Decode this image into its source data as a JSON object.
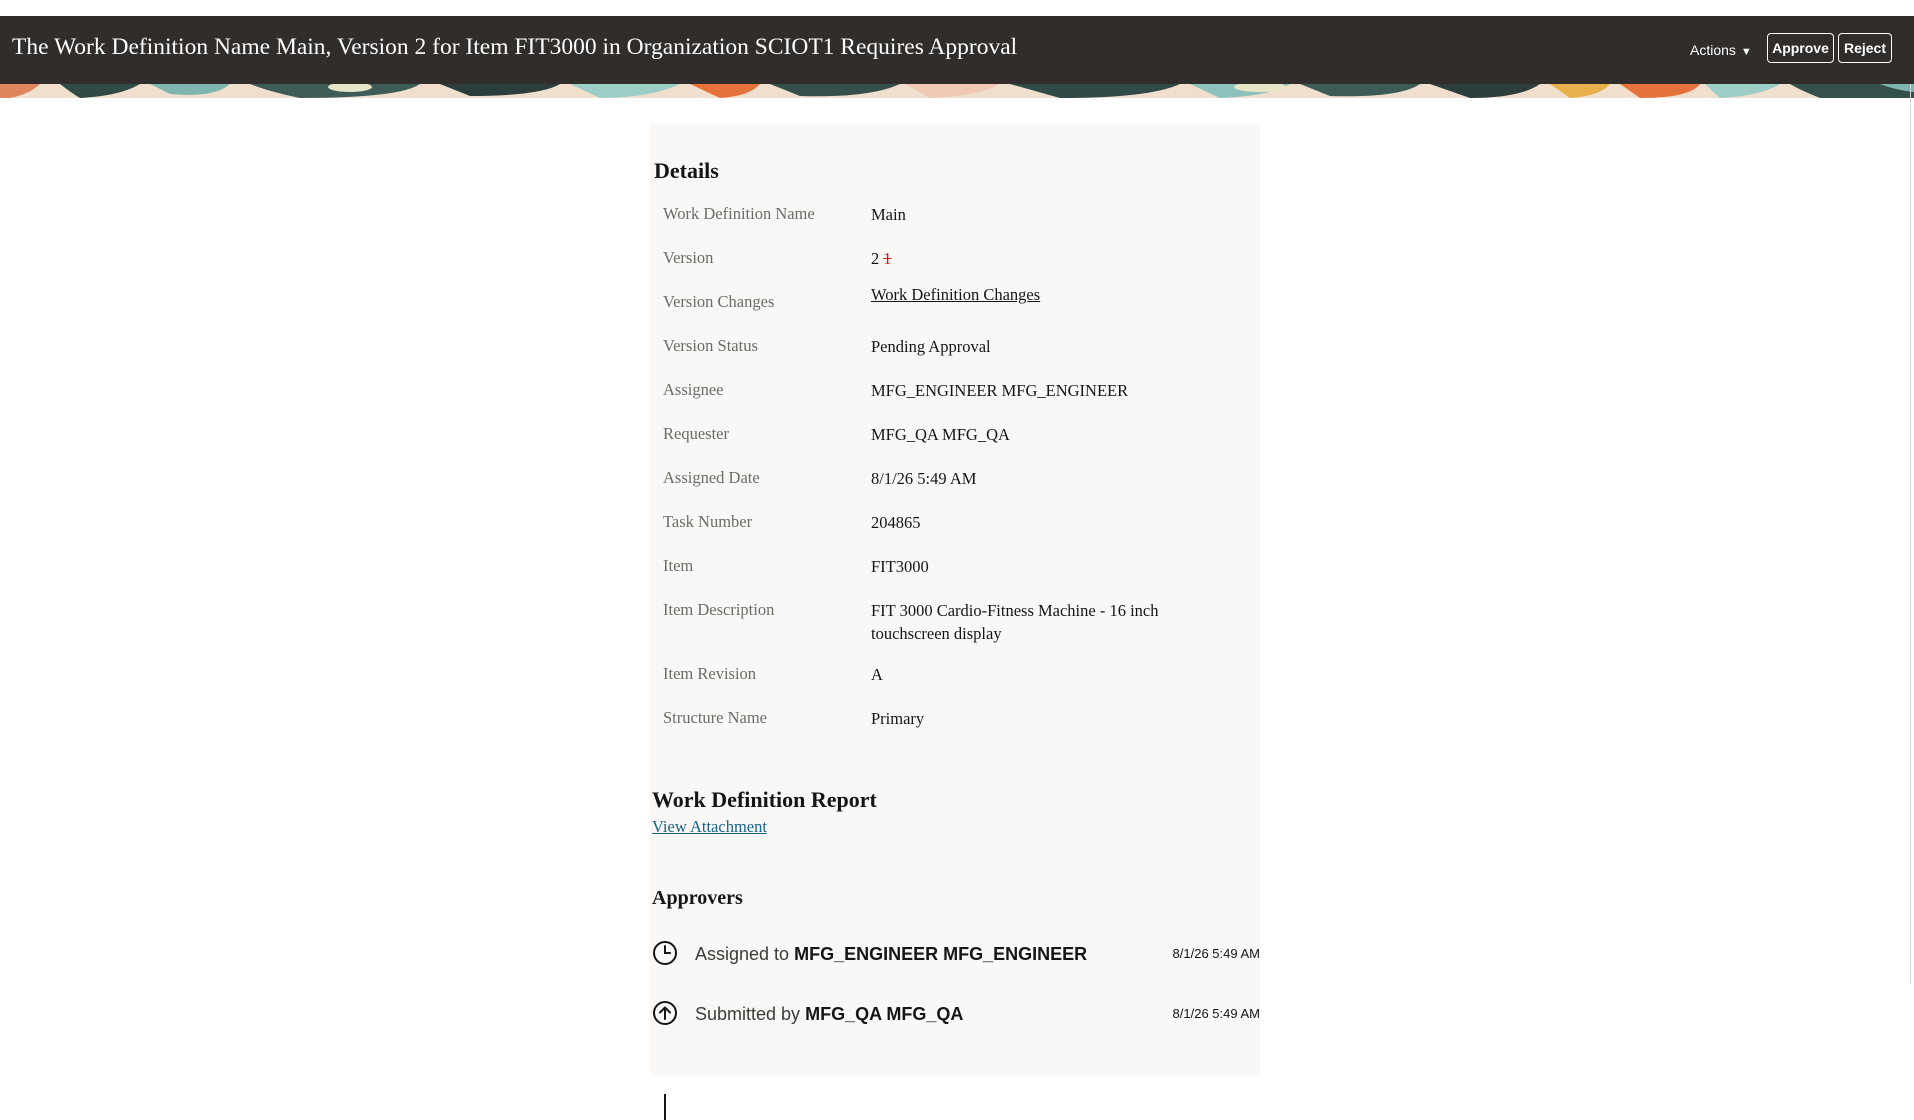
{
  "header": {
    "title": "The Work Definition Name Main, Version 2 for Item FIT3000 in Organization SCIOT1 Requires Approval",
    "actions_label": "Actions",
    "approve_label": "Approve",
    "reject_label": "Reject",
    "caret_icon": "chevron-down-icon",
    "background_color": "#312d2a"
  },
  "details": {
    "title": "Details",
    "fields": {
      "work_definition_name": {
        "label": "Work Definition Name",
        "value": "Main"
      },
      "version": {
        "label": "Version",
        "value": "2",
        "previous_value": "1"
      },
      "version_changes": {
        "label": "Version Changes",
        "value": "Work Definition Changes"
      },
      "version_status": {
        "label": "Version Status",
        "value": "Pending Approval"
      },
      "assignee": {
        "label": "Assignee",
        "value": "MFG_ENGINEER MFG_ENGINEER"
      },
      "requester": {
        "label": "Requester",
        "value": "MFG_QA MFG_QA"
      },
      "assigned_date": {
        "label": "Assigned Date",
        "value": "8/1/26 5:49 AM"
      },
      "task_number": {
        "label": "Task Number",
        "value": "204865"
      },
      "item": {
        "label": "Item",
        "value": "FIT3000"
      },
      "item_description": {
        "label": "Item Description",
        "value": "FIT 3000 Cardio-Fitness Machine - 16 inch touchscreen display"
      },
      "item_revision": {
        "label": "Item Revision",
        "value": "A"
      },
      "structure_name": {
        "label": "Structure Name",
        "value": "Primary"
      }
    }
  },
  "report": {
    "title": "Work Definition Report",
    "link_label": "View Attachment"
  },
  "approvers": {
    "title": "Approvers",
    "items": [
      {
        "prefix": "Assigned to",
        "name": "MFG_ENGINEER MFG_ENGINEER",
        "time": "8/1/26 5:49 AM",
        "icon": "clock-icon"
      },
      {
        "prefix": "Submitted by",
        "name": "MFG_QA MFG_QA",
        "time": "8/1/26 5:49 AM",
        "icon": "arrow-up-circle-icon"
      }
    ]
  },
  "colors": {
    "link": "#1b6285",
    "strikethrough": "#d11a1a",
    "card_background": "#f9f8f6",
    "label_text": "#6f6b66"
  }
}
